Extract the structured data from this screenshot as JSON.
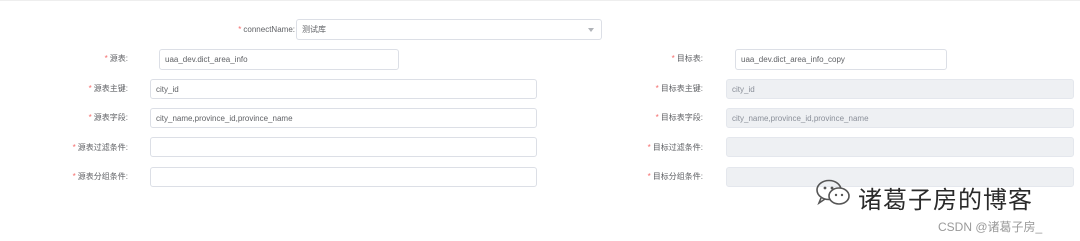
{
  "connect": {
    "label": "connectName:",
    "value": "测试库"
  },
  "left_form": {
    "source_table": {
      "label": "源表:",
      "value": "uaa_dev.dict_area_info"
    },
    "source_pk": {
      "label": "源表主键:",
      "value": "city_id"
    },
    "source_fields": {
      "label": "源表字段:",
      "value": "city_name,province_id,province_name"
    },
    "source_filter": {
      "label": "源表过滤条件:",
      "value": ""
    },
    "source_group": {
      "label": "源表分组条件:",
      "value": ""
    }
  },
  "right_form": {
    "target_table": {
      "label": "目标表:",
      "value": "uaa_dev.dict_area_info_copy"
    },
    "target_pk": {
      "label": "目标表主键:",
      "value": "city_id"
    },
    "target_fields": {
      "label": "目标表字段:",
      "value": "city_name,province_id,province_name"
    },
    "target_filter": {
      "label": "目标过滤条件:",
      "value": ""
    },
    "target_group": {
      "label": "目标分组条件:",
      "value": ""
    }
  },
  "watermark": {
    "text": "诸葛子房的博客",
    "csdn": "CSDN @诸葛子房_"
  },
  "required_mark": "*",
  "colors": {
    "required": "#f56c6c",
    "border": "#dcdfe6",
    "disabled_bg": "#eef0f3",
    "text": "#606266"
  },
  "icons": {
    "select_arrow": "chevron-down-icon",
    "watermark": "wechat-icon"
  }
}
